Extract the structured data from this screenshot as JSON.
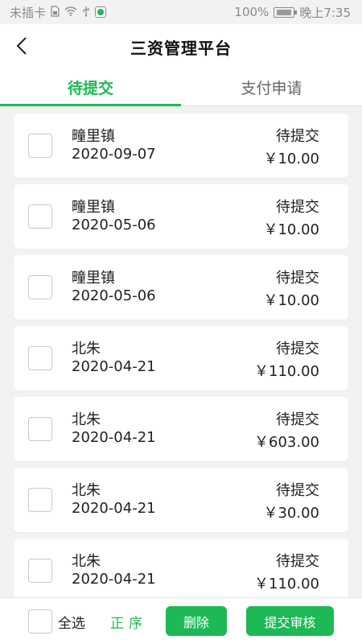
{
  "status_bar": {
    "carrier": "未插卡",
    "battery_percent": "100%",
    "time": "晚上7:35"
  },
  "header": {
    "title": "三资管理平台"
  },
  "tabs": [
    {
      "label": "待提交",
      "active": true
    },
    {
      "label": "支付申请",
      "active": false
    }
  ],
  "items": [
    {
      "place": "疃里镇",
      "date": "2020-09-07",
      "status": "待提交",
      "amount": "￥10.00"
    },
    {
      "place": "疃里镇",
      "date": "2020-05-06",
      "status": "待提交",
      "amount": "￥10.00"
    },
    {
      "place": "疃里镇",
      "date": "2020-05-06",
      "status": "待提交",
      "amount": "￥10.00"
    },
    {
      "place": "北朱",
      "date": "2020-04-21",
      "status": "待提交",
      "amount": "￥110.00"
    },
    {
      "place": "北朱",
      "date": "2020-04-21",
      "status": "待提交",
      "amount": "￥603.00"
    },
    {
      "place": "北朱",
      "date": "2020-04-21",
      "status": "待提交",
      "amount": "￥30.00"
    },
    {
      "place": "北朱",
      "date": "2020-04-21",
      "status": "待提交",
      "amount": "￥110.00"
    }
  ],
  "bottom_bar": {
    "select_all_label": "全选",
    "order_label": "正序",
    "delete_label": "删除",
    "submit_label": "提交审核"
  },
  "colors": {
    "accent": "#1db954"
  }
}
